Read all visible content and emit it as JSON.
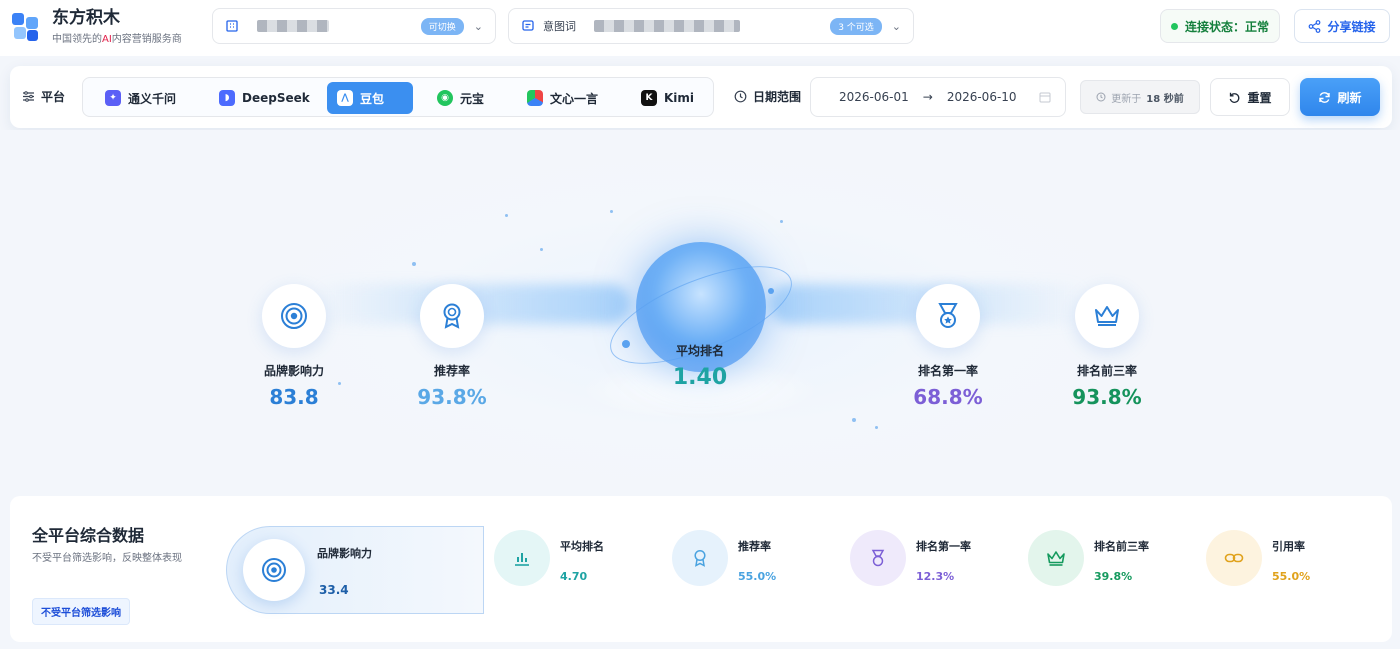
{
  "header": {
    "brand_name": "东方积木",
    "brand_sub_pre": "中国领先的",
    "brand_sub_ai": "AI",
    "brand_sub_post": "内容营销服务商",
    "brand_selector_badge": "可切换",
    "keyword_label": "意图词",
    "keyword_badge": "3 个可选",
    "connection": "连接状态：正常",
    "share": "分享链接"
  },
  "filter": {
    "platform_label": "平台",
    "platforms": [
      {
        "label": "通义千问",
        "color": "#4f5ff6"
      },
      {
        "label": "DeepSeek",
        "color": "#4d6bfe"
      },
      {
        "label": "豆包",
        "color": "#ffffff"
      },
      {
        "label": "元宝",
        "color": "#22c55e"
      },
      {
        "label": "文心一言",
        "color": "#2563eb"
      },
      {
        "label": "Kimi",
        "color": "#111111"
      }
    ],
    "active_platform": "豆包",
    "date_label": "日期范围",
    "date_start": "2026-06-01",
    "date_arrow": "→",
    "date_end": "2026-06-10",
    "updated_prefix": "更新于",
    "updated_value": "18 秒前",
    "reset": "重置",
    "refresh": "刷新"
  },
  "hero": {
    "center": {
      "label": "平均排名",
      "value": "1.40"
    },
    "kpis": [
      {
        "label": "品牌影响力",
        "value": "83.8",
        "color": "#2b7fd6",
        "icon": "target-icon"
      },
      {
        "label": "推荐率",
        "value": "93.8%",
        "color": "#5aa8e6",
        "icon": "award-icon"
      },
      {
        "label": "排名第一率",
        "value": "68.8%",
        "color": "#7c5fd6",
        "icon": "medal-icon"
      },
      {
        "label": "排名前三率",
        "value": "93.8%",
        "color": "#15935c",
        "icon": "crown-icon"
      }
    ]
  },
  "overall": {
    "title": "全平台综合数据",
    "desc": "不受平台筛选影响，反映整体表现",
    "tag": "不受平台筛选影响",
    "featured": {
      "label": "品牌影响力",
      "value": "33.4"
    },
    "cards": [
      {
        "label": "平均排名",
        "value": "4.70",
        "color": "#1ea3a3",
        "bg": "#e4f6f6",
        "icon": "bar-chart-icon"
      },
      {
        "label": "推荐率",
        "value": "55.0%",
        "color": "#4aa3e0",
        "bg": "#e6f2fc",
        "icon": "award-icon"
      },
      {
        "label": "排名第一率",
        "value": "12.3%",
        "color": "#7c5fd6",
        "bg": "#efeafb",
        "icon": "medal-icon"
      },
      {
        "label": "排名前三率",
        "value": "39.8%",
        "color": "#159a5e",
        "bg": "#e3f5ec",
        "icon": "crown-icon"
      },
      {
        "label": "引用率",
        "value": "55.0%",
        "color": "#e0a21c",
        "bg": "#fdf3df",
        "icon": "link-icon"
      }
    ]
  }
}
